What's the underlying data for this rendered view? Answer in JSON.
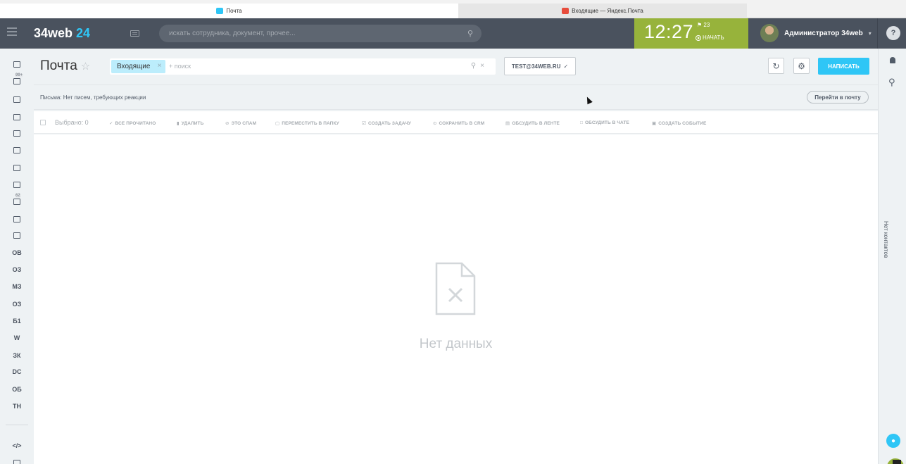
{
  "browser": {
    "tabs": [
      {
        "label": "Почта",
        "active": true,
        "icon": "mail-tab-icon",
        "icon_color": "#2fc6f6"
      },
      {
        "label": "Входящие — Яндекс.Почта",
        "active": false,
        "icon": "yandex-mail-icon",
        "icon_color": "#e74c3c"
      }
    ]
  },
  "header": {
    "logo_text": "34web",
    "logo_num": "24",
    "search_placeholder": "искать сотрудника, документ, прочее...",
    "time": "12:27",
    "flag_count": "23",
    "start_label": "НАЧАТЬ",
    "user_name": "Администратор 34web",
    "help": "?",
    "colors": {
      "bar": "#4a525e",
      "time_bg": "#97b33b",
      "accent": "#2fc6f6"
    }
  },
  "left_sidebar": {
    "items": [
      {
        "kind": "icon",
        "icon": "feed-icon"
      },
      {
        "kind": "icon",
        "icon": "tasks-icon",
        "badge": "99+"
      },
      {
        "kind": "icon",
        "icon": "chat-icon"
      },
      {
        "kind": "icon",
        "icon": "groups-icon"
      },
      {
        "kind": "icon",
        "icon": "drive-icon"
      },
      {
        "kind": "icon",
        "icon": "calendar-icon"
      },
      {
        "kind": "icon",
        "icon": "clock-icon"
      },
      {
        "kind": "icon",
        "icon": "robot-icon"
      },
      {
        "kind": "icon",
        "icon": "filter-icon",
        "badge": "62"
      },
      {
        "kind": "icon",
        "icon": "window-icon"
      },
      {
        "kind": "icon",
        "icon": "contact-card-icon"
      },
      {
        "kind": "text",
        "text": "ОВ"
      },
      {
        "kind": "text",
        "text": "ОЗ"
      },
      {
        "kind": "text",
        "text": "МЗ"
      },
      {
        "kind": "text",
        "text": "ОЗ"
      },
      {
        "kind": "text",
        "text": "Б1"
      },
      {
        "kind": "text",
        "text": "W"
      },
      {
        "kind": "text",
        "text": "ЗК"
      },
      {
        "kind": "text",
        "text": "DC"
      },
      {
        "kind": "text",
        "text": "ОБ"
      },
      {
        "kind": "text",
        "text": "ТН"
      },
      {
        "kind": "text",
        "text": "</>"
      },
      {
        "kind": "icon",
        "icon": "building-icon"
      }
    ]
  },
  "right_sidebar": {
    "no_contacts": "Нет контактов"
  },
  "page": {
    "title": "Почта",
    "filter_chip": "Входящие",
    "filter_placeholder": "+ поиск",
    "mailbox": "TEST@34WEB.RU",
    "write_label": "НАПИСАТЬ",
    "info_text": "Письма: Нет писем, требующих реакции",
    "goto_label": "Перейти в почту",
    "selected_label": "Выбрано: 0",
    "actions": [
      {
        "label": "ВСЕ ПРОЧИТАНО",
        "icon": "check-icon"
      },
      {
        "label": "УДАЛИТЬ",
        "icon": "trash-icon"
      },
      {
        "label": "ЭТО СПАМ",
        "icon": "spam-icon"
      },
      {
        "label": "ПЕРЕМЕСТИТЬ В ПАПКУ",
        "icon": "folder-icon"
      },
      {
        "label": "СОЗДАТЬ ЗАДАЧУ",
        "icon": "task-icon"
      },
      {
        "label": "СОХРАНИТЬ В CRM",
        "icon": "crm-icon"
      },
      {
        "label": "ОБСУДИТЬ В ЛЕНТЕ",
        "icon": "feed-post-icon"
      },
      {
        "label": "ОБСУДИТЬ В ЧАТЕ",
        "icon": "chat-bubble-icon"
      },
      {
        "label": "СОЗДАТЬ СОБЫТИЕ",
        "icon": "event-icon"
      }
    ],
    "empty_text": "Нет данных"
  }
}
